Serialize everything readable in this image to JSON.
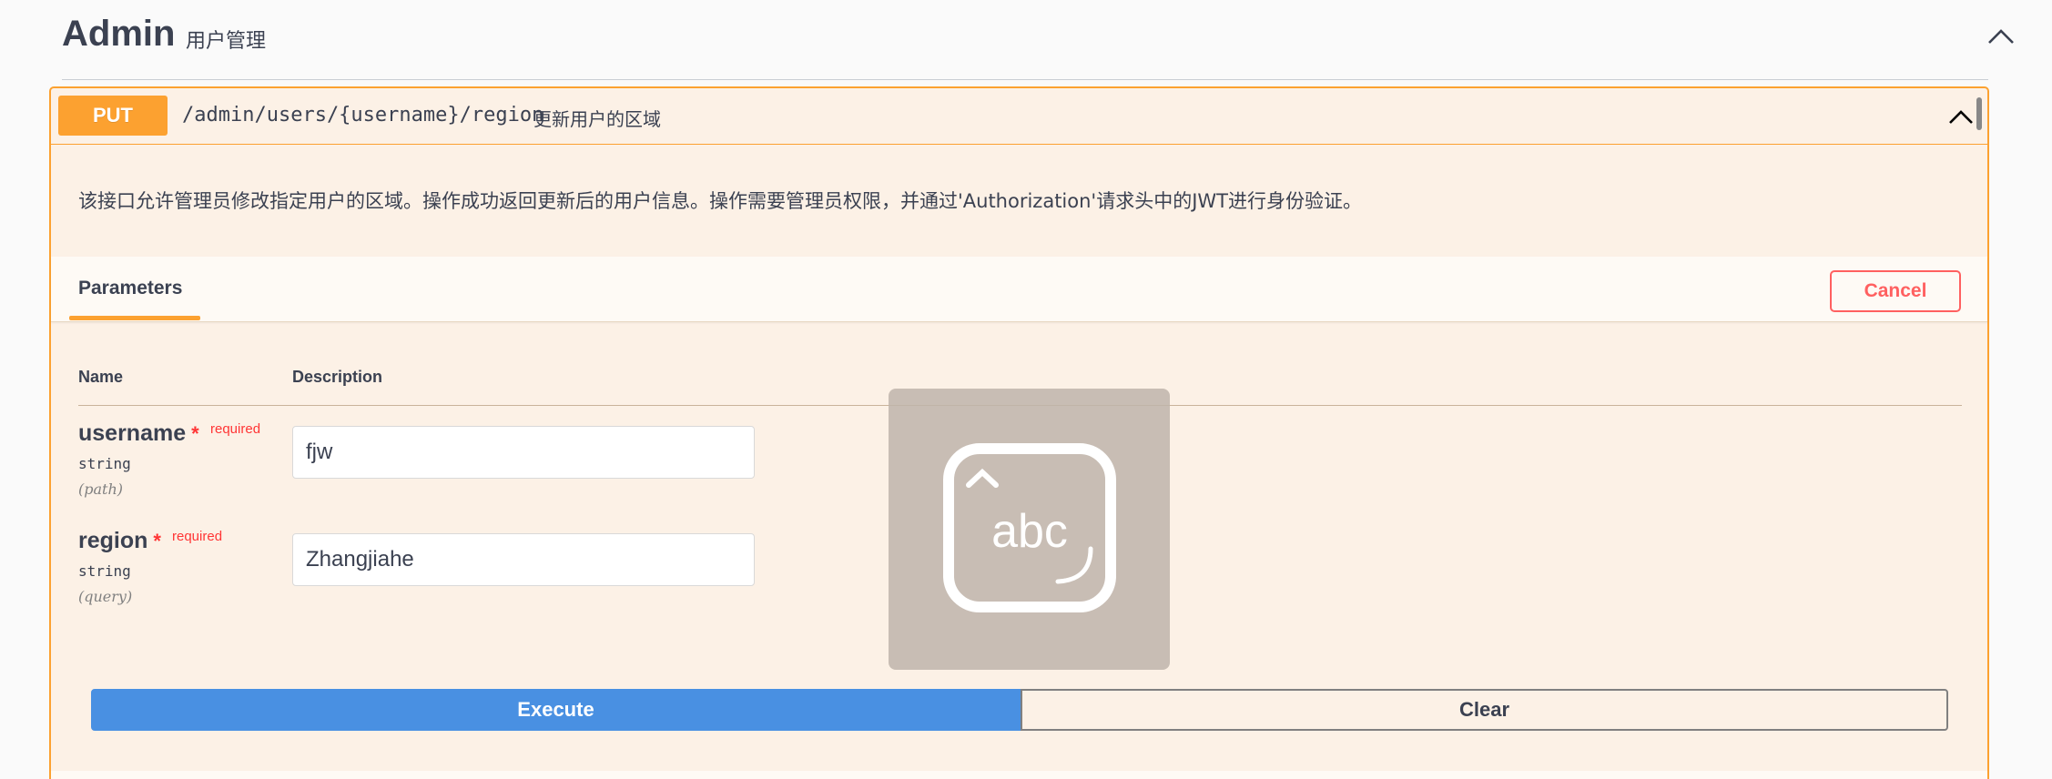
{
  "section": {
    "title": "Admin",
    "description": "用户管理",
    "collapse_icon": "chevron-up-icon"
  },
  "operation": {
    "method": "PUT",
    "path": "/admin/users/{username}/region",
    "summary": "更新用户的区域",
    "description": "该接口允许管理员修改指定用户的区域。操作成功返回更新后的用户信息。操作需要管理员权限，并通过'Authorization'请求头中的JWT进行身份验证。",
    "method_color": "#fca130",
    "collapse_icon": "chevron-up-icon"
  },
  "parameters": {
    "tab_label": "Parameters",
    "cancel_label": "Cancel",
    "columns": [
      "Name",
      "Description"
    ],
    "required_text": "required",
    "items": [
      {
        "name": "username",
        "type": "string",
        "in": "(path)",
        "value": "fjw"
      },
      {
        "name": "region",
        "type": "string",
        "in": "(query)",
        "value": "Zhangjiahe"
      }
    ]
  },
  "actions": {
    "execute_label": "Execute",
    "clear_label": "Clear",
    "execute_color": "#4990e2"
  },
  "ime_overlay": {
    "icon": "keyboard-abc-icon",
    "label": "abc"
  }
}
